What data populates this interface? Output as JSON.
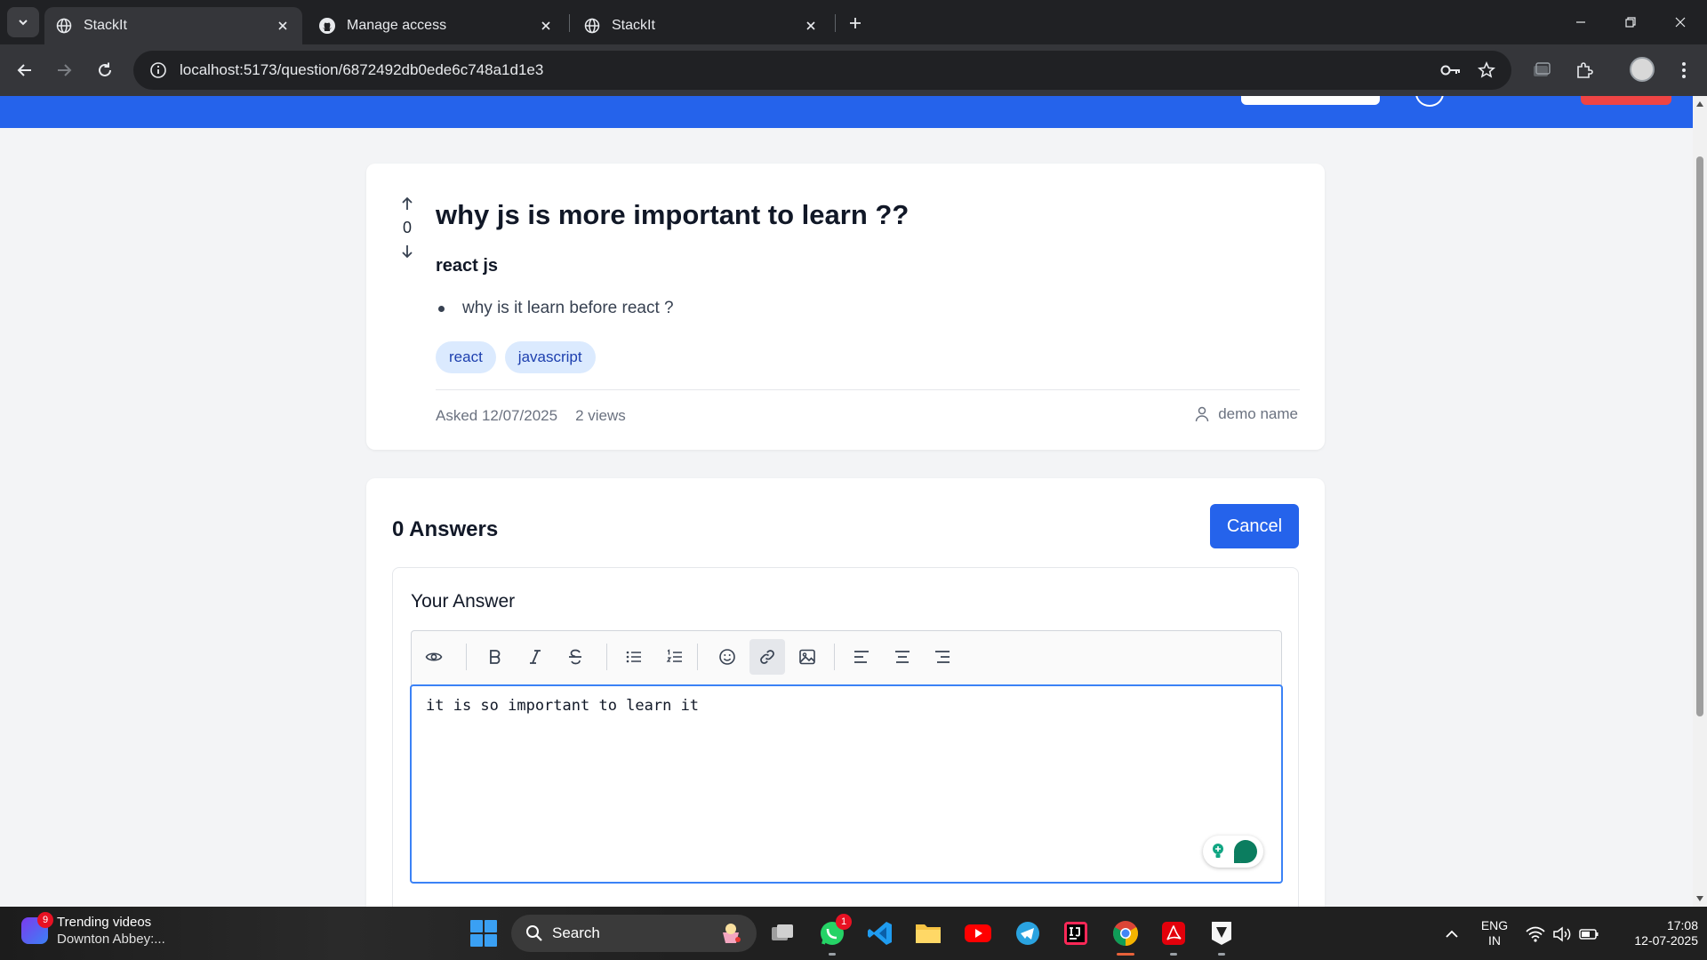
{
  "browser": {
    "tabs": [
      {
        "label": "StackIt",
        "icon": "globe-icon",
        "active": true
      },
      {
        "label": "Manage access",
        "icon": "github-icon",
        "active": false
      },
      {
        "label": "StackIt",
        "icon": "globe-icon",
        "active": false
      }
    ],
    "url": "localhost:5173/question/6872492db0ede6c748a1d1e3"
  },
  "question": {
    "vote_count": "0",
    "title": "why js is more important to learn ??",
    "subtitle": "react js",
    "bullets": [
      "why is it learn before react ?"
    ],
    "tags": [
      "react",
      "javascript"
    ],
    "asked": "Asked 12/07/2025",
    "views": "2 views",
    "author": "demo name"
  },
  "answers": {
    "heading": "0 Answers",
    "cancel_label": "Cancel",
    "your_answer_label": "Your Answer",
    "toolbar": [
      "preview-icon",
      "bold-icon",
      "italic-icon",
      "strikethrough-icon",
      "bullet-list-icon",
      "numbered-list-icon",
      "emoji-icon",
      "link-icon",
      "image-icon",
      "align-left-icon",
      "align-center-icon",
      "align-right-icon"
    ],
    "editor_text": "it is so important to learn it"
  },
  "taskbar": {
    "widget_title": "Trending videos",
    "widget_sub": "Downton Abbey:...",
    "widget_badge": "9",
    "search_label": "Search",
    "whatsapp_badge": "1",
    "lang_top": "ENG",
    "lang_bottom": "IN",
    "time": "17:08",
    "date": "12-07-2025"
  },
  "colors": {
    "brand": "#2563eb",
    "tag_bg": "#dbeafe",
    "tag_text": "#1e40af",
    "danger": "#ef4444"
  }
}
